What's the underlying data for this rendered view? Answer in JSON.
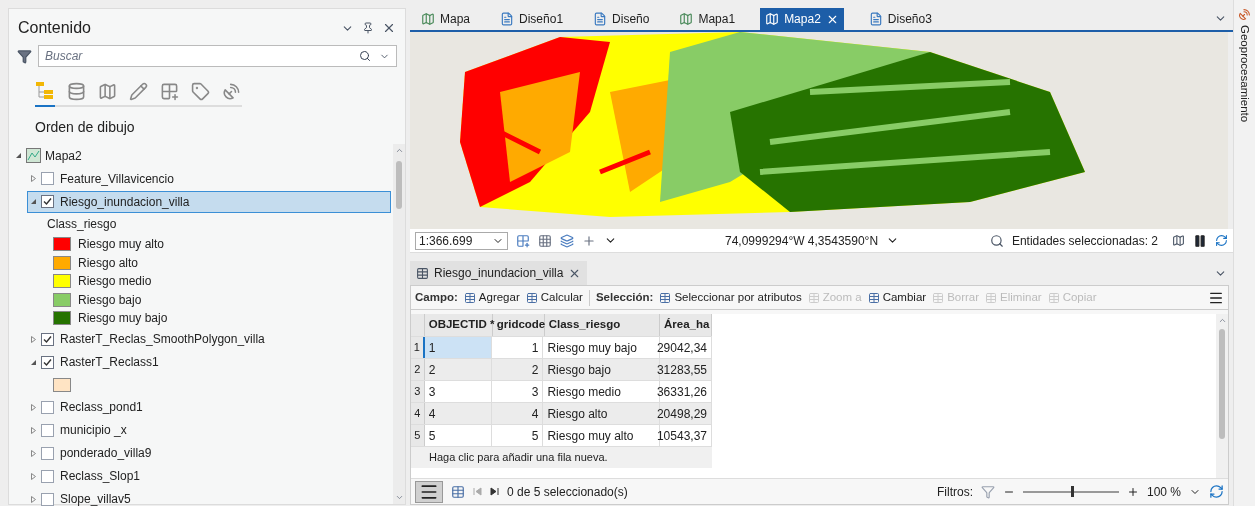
{
  "contents_panel": {
    "title": "Contenido",
    "search": {
      "placeholder": "Buscar"
    },
    "tool_tabs": [
      {
        "kind": "order",
        "selected": true
      },
      {
        "kind": "source",
        "selected": false
      },
      {
        "kind": "selection",
        "selected": false
      },
      {
        "kind": "editing",
        "selected": false
      },
      {
        "kind": "snapping",
        "selected": false
      },
      {
        "kind": "labeling",
        "selected": false
      },
      {
        "kind": "charts",
        "selected": false
      }
    ],
    "section_title": "Orden de dibujo",
    "tree": [
      {
        "label": "Mapa2",
        "expanded": true,
        "children": [
          {
            "label": "Feature_Villavicencio",
            "checked": false,
            "expanded": false,
            "selected": false
          },
          {
            "label": "Riesgo_inundacion_villa",
            "checked": true,
            "expanded": true,
            "selected": true,
            "legend": {
              "heading": "Class_riesgo",
              "classes": [
                {
                  "label": "Riesgo muy alto",
                  "color": "#ff0000"
                },
                {
                  "label": "Riesgo alto",
                  "color": "#ffaa00"
                },
                {
                  "label": "Riesgo medio",
                  "color": "#ffff00"
                },
                {
                  "label": "Riesgo bajo",
                  "color": "#88cc66"
                },
                {
                  "label": "Riesgo muy bajo",
                  "color": "#267300"
                }
              ]
            }
          },
          {
            "label": "RasterT_Reclas_SmoothPolygon_villa",
            "checked": true,
            "expanded": false,
            "selected": false
          },
          {
            "label": "RasterT_Reclass1",
            "checked": true,
            "expanded": true,
            "selected": false,
            "legend": {
              "classes": [
                {
                  "color": "#ffe4c4"
                }
              ]
            }
          },
          {
            "label": "Reclass_pond1",
            "checked": false,
            "expanded": false,
            "selected": false
          },
          {
            "label": "municipio _x",
            "checked": false,
            "expanded": false,
            "selected": false
          },
          {
            "label": "ponderado_villa9",
            "checked": false,
            "expanded": false,
            "selected": false
          },
          {
            "label": "Reclass_Slop1",
            "checked": false,
            "expanded": false,
            "selected": false
          },
          {
            "label": "Slope_villav5",
            "checked": false,
            "expanded": false,
            "selected": false
          }
        ]
      }
    ]
  },
  "view_tabs": [
    {
      "label": "Mapa",
      "kind": "map",
      "selected": false
    },
    {
      "label": "Diseño1",
      "kind": "layout",
      "selected": false
    },
    {
      "label": "Diseño",
      "kind": "layout",
      "selected": false
    },
    {
      "label": "Mapa1",
      "kind": "map",
      "selected": false
    },
    {
      "label": "Mapa2",
      "kind": "map",
      "selected": true
    },
    {
      "label": "Diseño3",
      "kind": "layout",
      "selected": false
    }
  ],
  "map_status": {
    "scale": "1:366.699",
    "coordinates": "74,0999294°W 4,3543590°N",
    "selected_features": "Entidades seleccionadas: 2"
  },
  "table_view": {
    "tab": "Riesgo_inundacion_villa",
    "toolbar": [
      {
        "kind": "label",
        "label": "Campo:"
      },
      {
        "kind": "button",
        "label": "Agregar",
        "disabled": false
      },
      {
        "kind": "button",
        "label": "Calcular",
        "disabled": false
      },
      {
        "kind": "separator"
      },
      {
        "kind": "label",
        "label": "Selección:"
      },
      {
        "kind": "button",
        "label": "Seleccionar por atributos",
        "disabled": false
      },
      {
        "kind": "button",
        "label": "Zoom a",
        "disabled": true
      },
      {
        "kind": "button",
        "label": "Cambiar",
        "disabled": false
      },
      {
        "kind": "button",
        "label": "Borrar",
        "disabled": true
      },
      {
        "kind": "button",
        "label": "Eliminar",
        "disabled": true
      },
      {
        "kind": "button",
        "label": "Copiar",
        "disabled": true
      }
    ],
    "columns": [
      {
        "label": "OBJECTID *"
      },
      {
        "label": "gridcode"
      },
      {
        "label": "Class_riesgo"
      },
      {
        "label": "Área_ha"
      }
    ],
    "rows": [
      {
        "number": "1",
        "selected": true,
        "cells": [
          "1",
          "1",
          "Riesgo muy bajo",
          "29042,34"
        ]
      },
      {
        "number": "2",
        "selected": false,
        "cells": [
          "2",
          "2",
          "Riesgo bajo",
          "31283,55"
        ]
      },
      {
        "number": "3",
        "selected": false,
        "cells": [
          "3",
          "3",
          "Riesgo medio",
          "36331,26"
        ]
      },
      {
        "number": "4",
        "selected": false,
        "cells": [
          "4",
          "4",
          "Riesgo alto",
          "20498,29"
        ]
      },
      {
        "number": "5",
        "selected": false,
        "cells": [
          "5",
          "5",
          "Riesgo muy alto",
          "10543,37"
        ]
      }
    ],
    "add_row": "Haga clic para añadir una fila nueva.",
    "footer": {
      "selection": "0 de 5 seleccionado(s)",
      "filters_label": "Filtros:",
      "zoom": {
        "level": 0.5,
        "reading": "100 %"
      }
    }
  },
  "side_pane": {
    "label": "Geoprocesamiento"
  }
}
